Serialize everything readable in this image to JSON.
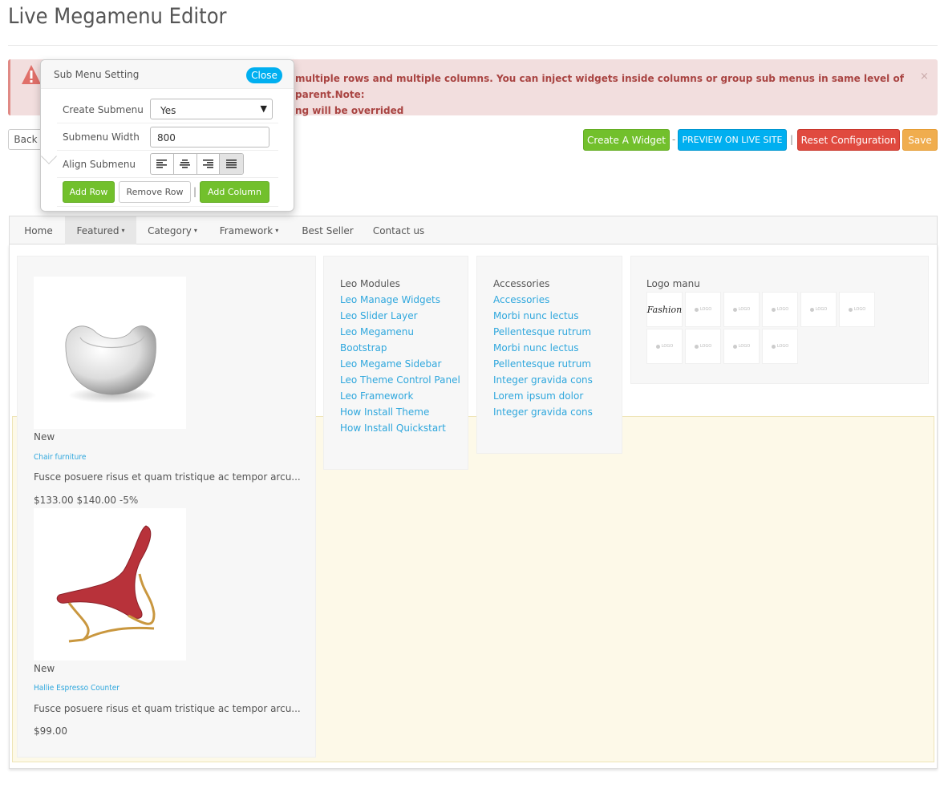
{
  "page": {
    "title": "Live Megamenu Editor"
  },
  "alert": {
    "text": "multiple rows and multiple columns. You can inject widgets inside columns or group sub menus in same level of parent.Note:",
    "text2": "ng will be overrided",
    "close": "×"
  },
  "toolbar": {
    "back": "Back",
    "create_widget": "Create A Widget",
    "dash": "-",
    "preview": "PREVIEW ON LIVE SITE",
    "pipe": "|",
    "reset": "Reset Configuration",
    "save": "Save"
  },
  "popover": {
    "title": "Sub Menu Setting",
    "close": "Close",
    "create_submenu_label": "Create Submenu",
    "create_submenu_value": "Yes",
    "submenu_width_label": "Submenu Width",
    "submenu_width_value": "800",
    "align_label": "Align Submenu",
    "align_active": "justify",
    "add_row": "Add Row",
    "remove_row": "Remove Row",
    "pipe": "|",
    "add_column": "Add Column"
  },
  "nav": {
    "items": [
      "Home",
      "Featured",
      "Category",
      "Framework",
      "Best Seller",
      "Contact us"
    ],
    "caret": "▾",
    "active": "Featured"
  },
  "products": [
    {
      "badge": "New",
      "name": "Chair furniture",
      "desc": "Fusce posuere risus et quam tristique ac tempor arcu...",
      "price": "$133.00 $140.00 -5%"
    },
    {
      "badge": "New",
      "name": "Hallie Espresso Counter",
      "desc": "Fusce posuere risus et quam tristique ac tempor arcu...",
      "price": "$99.00"
    }
  ],
  "leo_modules": {
    "title": "Leo Modules",
    "links": [
      "Leo Manage Widgets",
      "Leo Slider Layer",
      "Leo Megamenu",
      "Bootstrap",
      "Leo Megame Sidebar",
      "Leo Theme Control Panel",
      "Leo Framework",
      "How Install Theme",
      "How Install Quickstart"
    ]
  },
  "accessories": {
    "title": "Accessories",
    "links": [
      "Accessories",
      "Morbi nunc lectus",
      "Pellentesque rutrum",
      "Morbi nunc lectus",
      "Pellentesque rutrum",
      "Integer gravida cons",
      "Lorem ipsum dolor",
      "Integer gravida cons"
    ]
  },
  "logo_menu": {
    "title": "Logo manu",
    "first_logo": "Fashion",
    "placeholder": "LOGO"
  },
  "colors": {
    "green": "#72c02c",
    "blue": "#00aff0",
    "red": "#e04a3f",
    "orange": "#f0ad4e",
    "link": "#2fa7dd",
    "alert_bg": "#f2dede"
  }
}
